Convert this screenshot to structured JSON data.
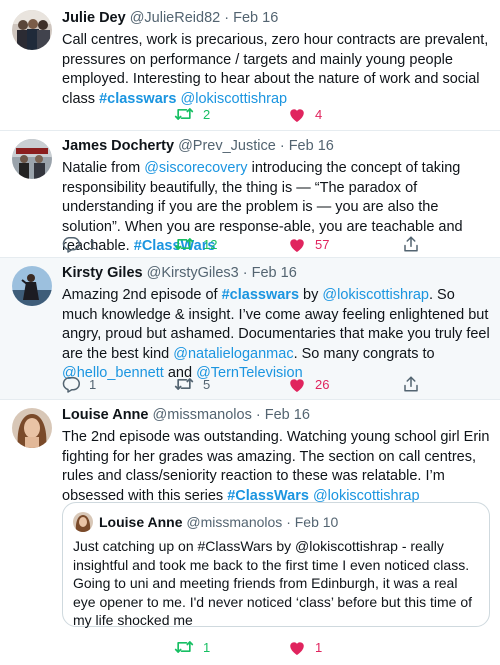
{
  "tweets": [
    {
      "name": "Julie Dey",
      "handle": "@JulieReid82",
      "date": "Feb 16",
      "text_a": "Call centres, work is precarious, zero hour contracts are prevalent, pressures on performance / targets and mainly young people employed. Interesting to hear about the nature of work and social class ",
      "hashtag": "#classwars",
      "mention": "@lokiscottishrap",
      "retweets": "2",
      "likes": "4"
    },
    {
      "name": "James Docherty",
      "handle": "@Prev_Justice",
      "date": "Feb 16",
      "text_a": "Natalie from ",
      "mention": "@siscorecovery",
      "text_b": " introducing the concept of taking responsibility beautifully, the thing is — “The paradox of understanding if you are the problem is — you are also the solution”.  When you are response-able, you are teachable and reachable. ",
      "hashtag": "#ClassWars",
      "replies": "1",
      "retweets": "12",
      "likes": "57"
    },
    {
      "name": "Kirsty Giles",
      "handle": "@KirstyGiles3",
      "date": "Feb 16",
      "text_a": "Amazing 2nd episode of ",
      "hashtag": "#classwars",
      "text_b": " by ",
      "mention1": "@lokiscottishrap",
      "text_c": ". So much knowledge & insight. I’ve come away feeling enlightened but angry, proud but ashamed. Documentaries that make you truly feel are the best kind ",
      "mention2": "@natalieloganmac",
      "text_d": ". So many congrats to ",
      "mention3": "@hello_bennett",
      "text_e": " and ",
      "mention4": "@TernTelevision",
      "replies": "1",
      "retweets": "5",
      "likes": "26"
    },
    {
      "name": "Louise Anne",
      "handle": "@missmanolos",
      "date": "Feb 16",
      "text_a": "The 2nd episode was outstanding. Watching young school girl Erin fighting for her grades was amazing. The section on call centres, rules and class/seniority reaction to these was relatable. I’m obsessed with this series ",
      "hashtag": "#ClassWars",
      "mention": "@lokiscottishrap",
      "quote": {
        "name": "Louise Anne",
        "handle": "@missmanolos",
        "date": "Feb 10",
        "text": "Just catching up on #ClassWars by @lokiscottishrap - really insightful and took me back to the first time I even noticed class. Going to uni and meeting friends from Edinburgh, it was a real eye opener to me. I'd never noticed ‘class’ before but this time of my life shocked me"
      },
      "retweets": "1",
      "likes": "1"
    }
  ],
  "separator": "·",
  "colors": {
    "link": "#1b95e0",
    "retweet_active": "#17bf63",
    "like_active": "#e0245e",
    "muted": "#536471"
  }
}
